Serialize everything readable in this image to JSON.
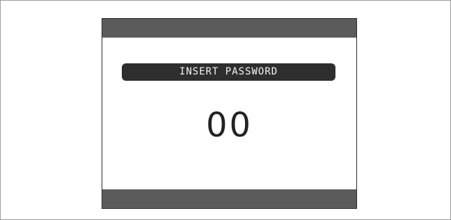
{
  "screen": {
    "prompt": "INSERT PASSWORD",
    "password_value": "00"
  },
  "colors": {
    "bar": "#5b5b5b",
    "pill": "#2e2e2e",
    "text_light": "#f5f5f5",
    "text_dark": "#222222"
  }
}
